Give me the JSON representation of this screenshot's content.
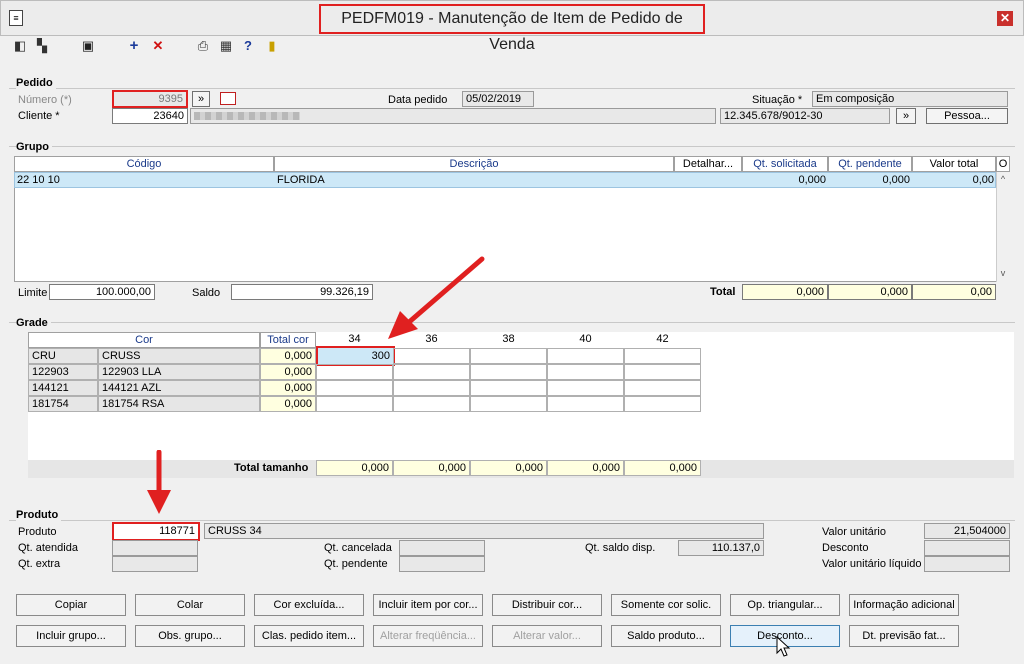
{
  "window": {
    "title": "PEDFM019 - Manutenção de Item de Pedido de Venda",
    "close": "✕"
  },
  "pedido": {
    "section": "Pedido",
    "numero_label": "Número (*)",
    "numero": "9395",
    "cliente_label": "Cliente *",
    "cliente": "23640",
    "data_label": "Data pedido",
    "data": "05/02/2019",
    "situacao_label": "Situação *",
    "situacao": "Em composição",
    "cnpj": "12.345.678/9012-30",
    "go": "»",
    "pessoa_btn": "Pessoa..."
  },
  "grupo": {
    "section": "Grupo",
    "headers": {
      "codigo": "Código",
      "descricao": "Descrição",
      "detalhar": "Detalhar...",
      "qt_solicitada": "Qt. solicitada",
      "qt_pendente": "Qt. pendente",
      "valor_total": "Valor total",
      "o": "O"
    },
    "row": {
      "codigo": "22 10 10",
      "descricao": "FLORIDA",
      "qt_solicitada": "0,000",
      "qt_pendente": "0,000",
      "valor_total": "0,00"
    },
    "limite_label": "Limite",
    "limite": "100.000,00",
    "saldo_label": "Saldo",
    "saldo": "99.326,19",
    "total_label": "Total",
    "total_solicitada": "0,000",
    "total_pendente": "0,000",
    "total_valor": "0,00"
  },
  "grade": {
    "section": "Grade",
    "cor_header": "Cor",
    "total_cor_header": "Total cor",
    "sizes": [
      "34",
      "36",
      "38",
      "40",
      "42"
    ],
    "rows": [
      {
        "code": "CRU",
        "name": "CRUSS",
        "total": "0,000",
        "s34": "300"
      },
      {
        "code": "122903",
        "name": "122903 LLA",
        "total": "0,000",
        "s34": ""
      },
      {
        "code": "144121",
        "name": "144121 AZL",
        "total": "0,000",
        "s34": ""
      },
      {
        "code": "181754",
        "name": "181754 RSA",
        "total": "0,000",
        "s34": ""
      }
    ],
    "total_tamanho_label": "Total tamanho",
    "totals": [
      "0,000",
      "0,000",
      "0,000",
      "0,000",
      "0,000"
    ]
  },
  "produto": {
    "section": "Produto",
    "produto_label": "Produto",
    "produto_code": "118771",
    "produto_name": "CRUSS 34",
    "qt_atendida_label": "Qt. atendida",
    "qt_extra_label": "Qt. extra",
    "qt_cancelada_label": "Qt. cancelada",
    "qt_pendente_label": "Qt. pendente",
    "qt_saldo_label": "Qt. saldo disp.",
    "qt_saldo": "110.137,0",
    "valor_unitario_label": "Valor unitário",
    "valor_unitario": "21,504000",
    "desconto_label": "Desconto",
    "valor_liquido_label": "Valor unitário líquido"
  },
  "buttons": {
    "row1": [
      "Copiar",
      "Colar",
      "Cor excluída...",
      "Incluir item por cor...",
      "Distribuir cor...",
      "Somente cor solic.",
      "Op. triangular...",
      "Informação adicional"
    ],
    "row2": [
      "Incluir grupo...",
      "Obs. grupo...",
      "Clas. pedido item...",
      "Alterar freqüência...",
      "Alterar valor...",
      "Saldo produto...",
      "Desconto...",
      "Dt. previsão fat..."
    ]
  },
  "colors": {
    "annotation": "#e02020",
    "header_text": "#1a3a8a",
    "highlight_row": "#cde8f7",
    "yellow_field": "#ffffe0"
  }
}
